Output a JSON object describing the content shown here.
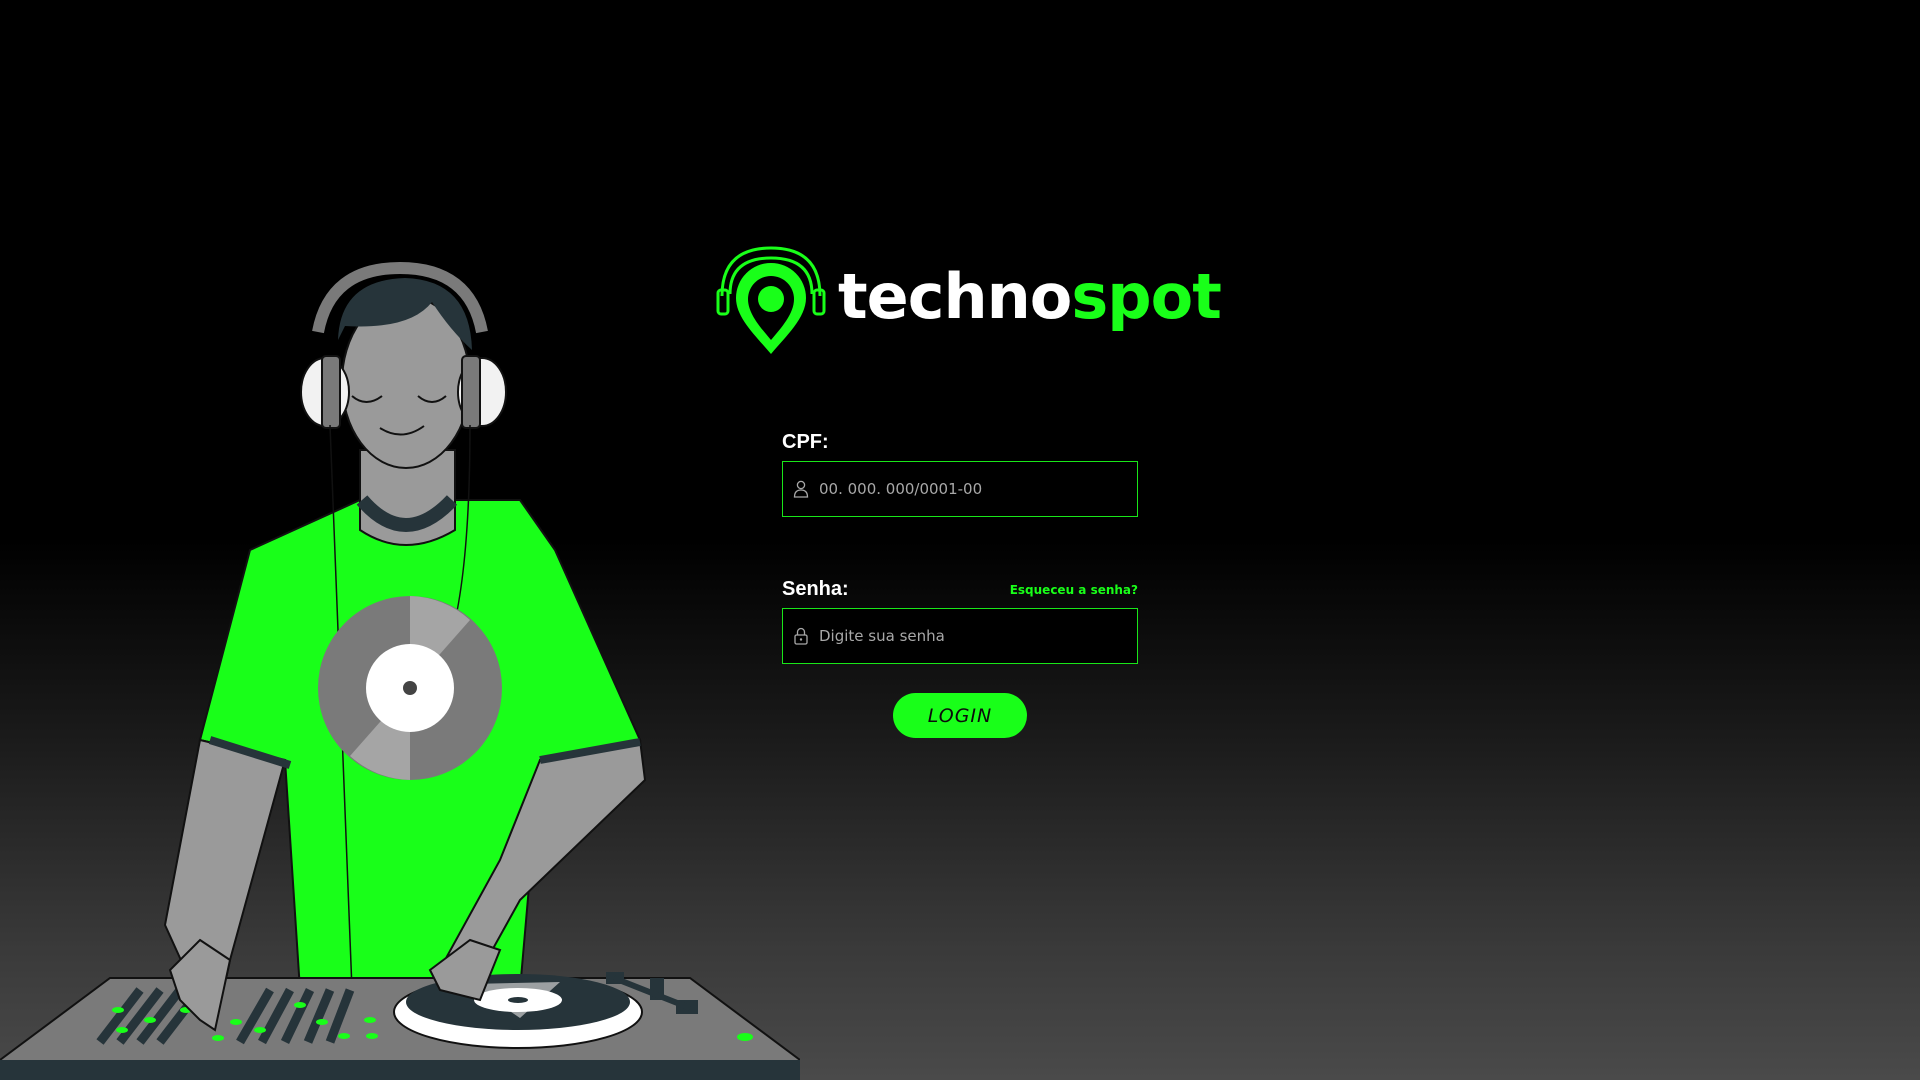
{
  "brand": {
    "name_white": "techno",
    "name_green": "spot",
    "accent_color": "#19ff19"
  },
  "form": {
    "cpf": {
      "label": "CPF:",
      "placeholder": "00. 000. 000/0001-00",
      "value": "",
      "icon": "user-icon"
    },
    "password": {
      "label": "Senha:",
      "placeholder": "Digite sua senha",
      "value": "",
      "icon": "lock-icon"
    },
    "forgot_link": "Esqueceu a senha?",
    "submit_label": "LOGIN"
  },
  "illustration": {
    "subject": "dj-illustration"
  }
}
